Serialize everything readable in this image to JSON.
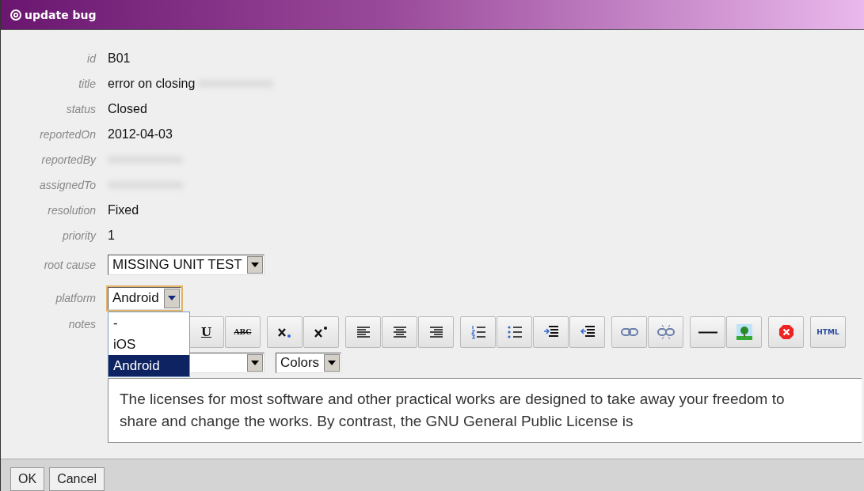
{
  "window": {
    "title": "update bug"
  },
  "fields": [
    {
      "label": "id",
      "value": "B01",
      "redacted": false
    },
    {
      "label": "title",
      "value": "error on closing",
      "redacted": true
    },
    {
      "label": "status",
      "value": "Closed",
      "redacted": false
    },
    {
      "label": "reportedOn",
      "value": "2012-04-03",
      "redacted": false
    },
    {
      "label": "reportedBy",
      "redacted": true
    },
    {
      "label": "assignedTo",
      "redacted": true
    },
    {
      "label": "resolution",
      "value": "Fixed",
      "redacted": false
    },
    {
      "label": "priority",
      "value": "1",
      "redacted": false
    }
  ],
  "root_cause": {
    "label": "root cause",
    "value": "MISSING UNIT TEST"
  },
  "platform": {
    "label": "platform",
    "value": "Android",
    "expanded": true,
    "options": [
      {
        "label": "-",
        "selected": false
      },
      {
        "label": "iOS",
        "selected": false
      },
      {
        "label": "Android",
        "selected": true
      }
    ]
  },
  "notes": {
    "label": "notes",
    "toolbar": [
      {
        "items": [
          {
            "kind": "underline",
            "label": "U"
          },
          {
            "kind": "strike",
            "label": "ABC"
          }
        ]
      },
      {
        "items": [
          {
            "kind": "subscript"
          },
          {
            "kind": "superscript"
          }
        ]
      },
      {
        "items": [
          {
            "kind": "align-left"
          },
          {
            "kind": "align-center"
          },
          {
            "kind": "align-right"
          }
        ]
      },
      {
        "items": [
          {
            "kind": "ordered-list"
          },
          {
            "kind": "bullet-list"
          },
          {
            "kind": "indent"
          },
          {
            "kind": "outdent"
          }
        ]
      },
      {
        "items": [
          {
            "kind": "link"
          },
          {
            "kind": "unlink"
          }
        ]
      },
      {
        "items": [
          {
            "kind": "rule"
          },
          {
            "kind": "image"
          }
        ]
      },
      {
        "items": [
          {
            "kind": "remove"
          }
        ]
      },
      {
        "items": [
          {
            "kind": "html",
            "label": "HTML"
          }
        ]
      }
    ],
    "colors_select": {
      "value": "Colors"
    },
    "text": "The licenses for most software and other practical works are designed to take away your freedom to share and change the works. By contrast, the GNU General Public License is"
  },
  "buttons": [
    "OK",
    "Cancel"
  ]
}
